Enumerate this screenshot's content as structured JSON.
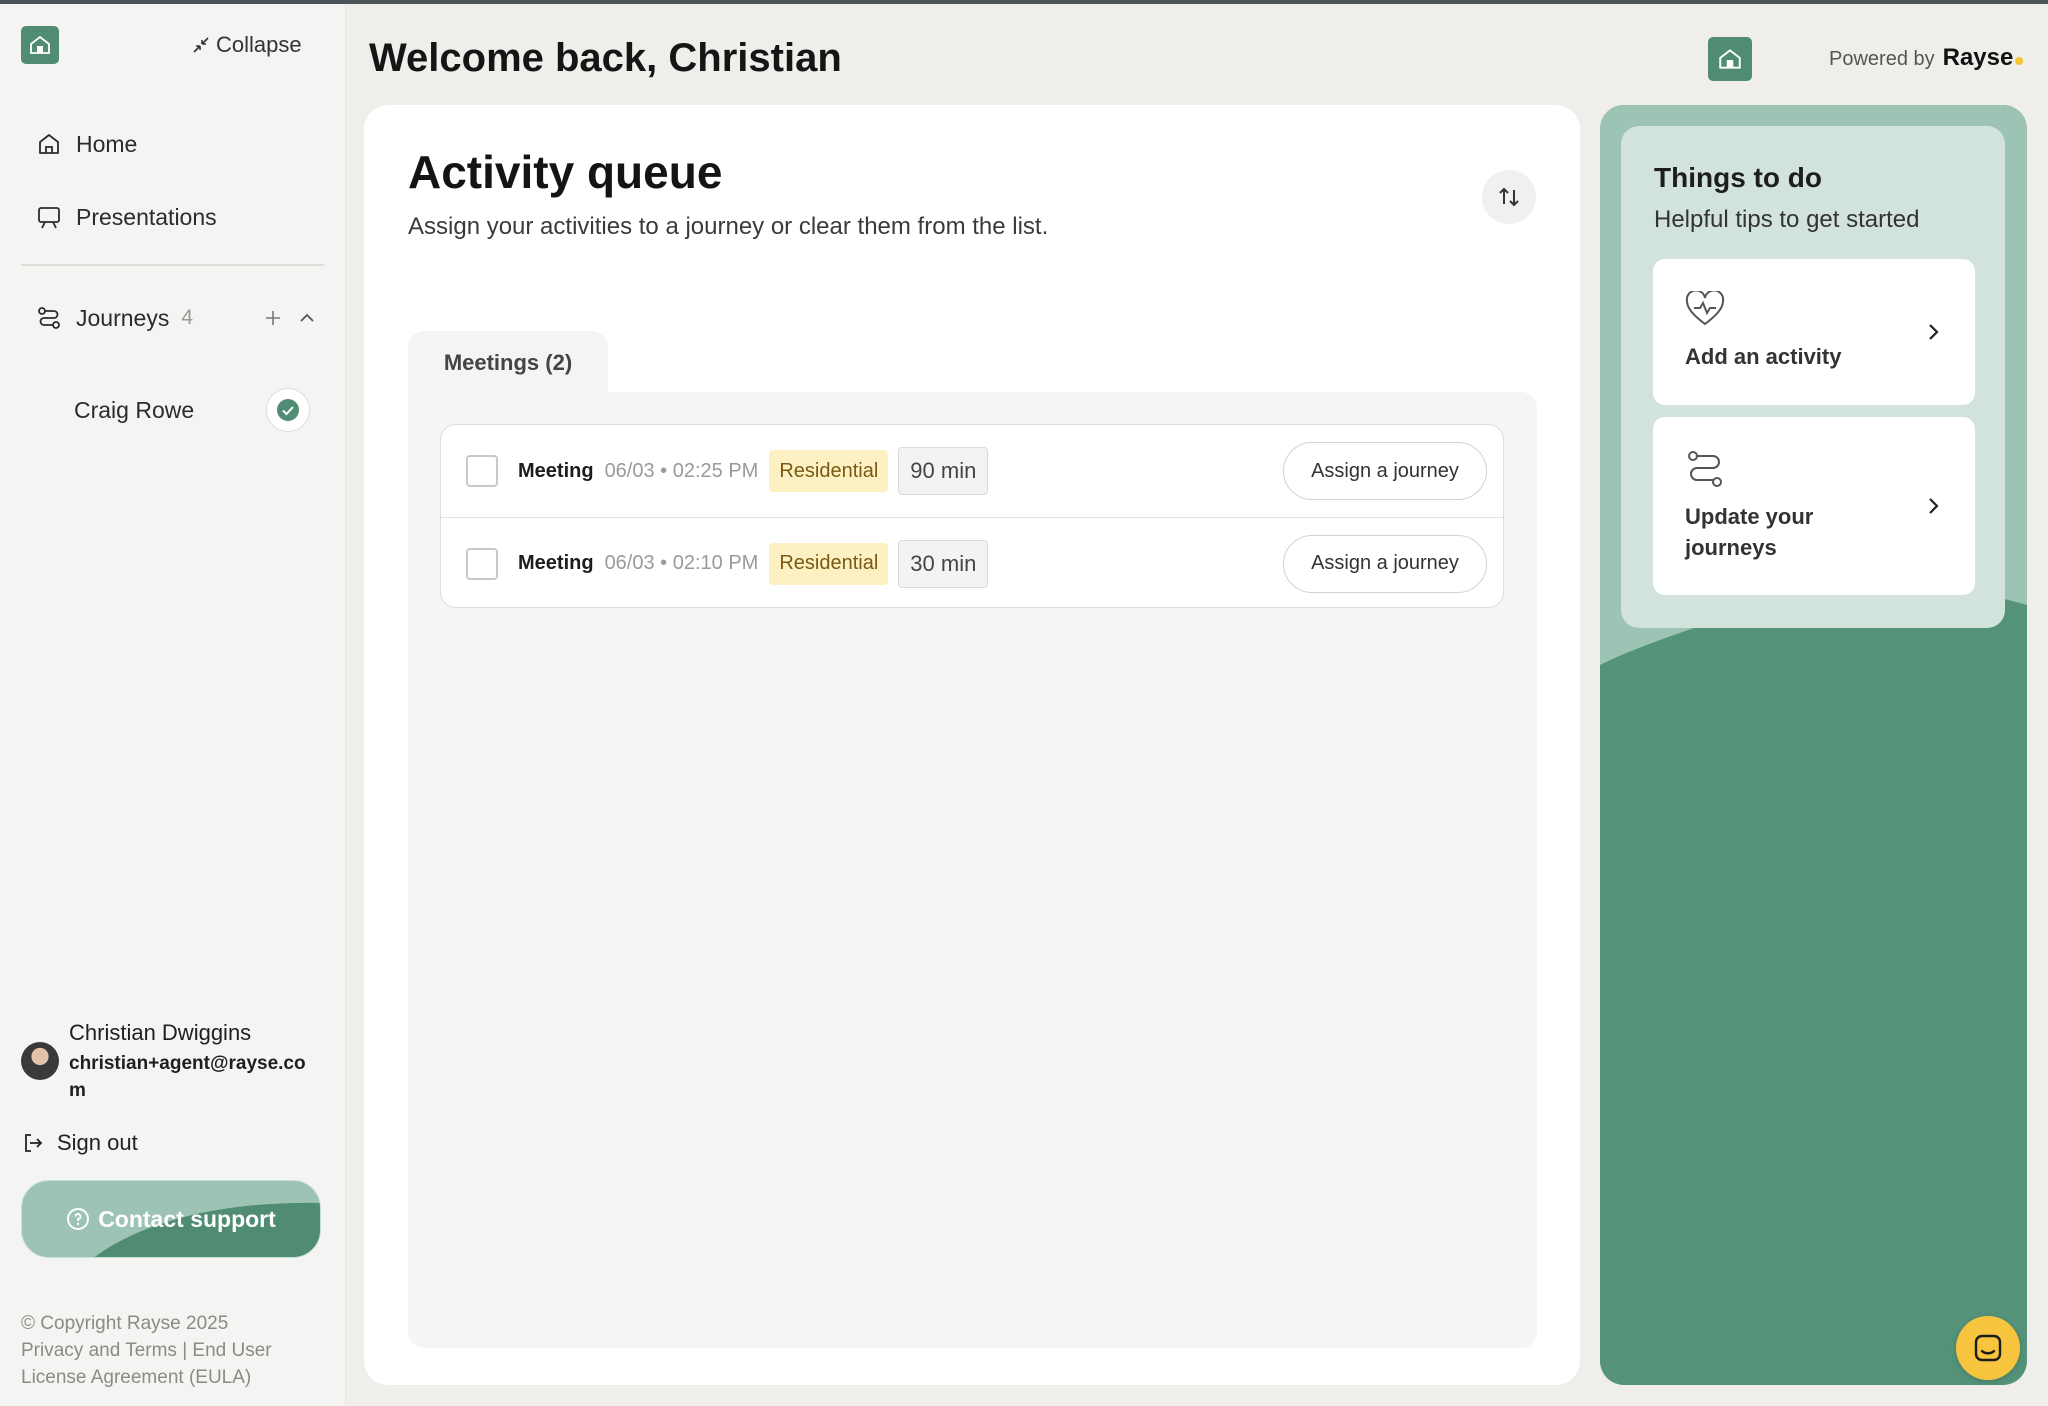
{
  "sidebar": {
    "collapse_label": "Collapse",
    "nav": [
      {
        "label": "Home",
        "icon": "home-icon"
      },
      {
        "label": "Presentations",
        "icon": "presentation-icon"
      }
    ],
    "journeys": {
      "label": "Journeys",
      "count": "4",
      "children": [
        {
          "name": "Craig Rowe",
          "status": "complete"
        }
      ]
    },
    "user": {
      "name": "Christian Dwiggins",
      "email": "christian+agent@rayse.com"
    },
    "signout_label": "Sign out",
    "support_label": "Contact support",
    "footer": {
      "copyright": "© Copyright Rayse 2025",
      "links": "Privacy and Terms | End User License Agreement (EULA)"
    }
  },
  "header": {
    "title": "Welcome back, Christian",
    "powered_by": "Powered by",
    "brand": "Rayse"
  },
  "main": {
    "title": "Activity queue",
    "subtitle": "Assign your activities to a journey or clear them from the list.",
    "tab_label": "Meetings (2)",
    "rows": [
      {
        "type": "Meeting",
        "date": "06/03 • 02:25 PM",
        "badge": "Residential",
        "duration": "90 min",
        "action": "Assign a journey"
      },
      {
        "type": "Meeting",
        "date": "06/03 • 02:10 PM",
        "badge": "Residential",
        "duration": "30 min",
        "action": "Assign a journey"
      }
    ]
  },
  "todo": {
    "title": "Things to do",
    "subtitle": "Helpful tips to get started",
    "tips": [
      {
        "label": "Add an activity",
        "icon": "heart-pulse-icon"
      },
      {
        "label": "Update your journeys",
        "icon": "route-icon"
      }
    ]
  },
  "colors": {
    "brand_green": "#549279",
    "light_green": "#d2e3dc",
    "badge_bg": "#fdf1c4",
    "accent_yellow": "#f7c43d"
  }
}
